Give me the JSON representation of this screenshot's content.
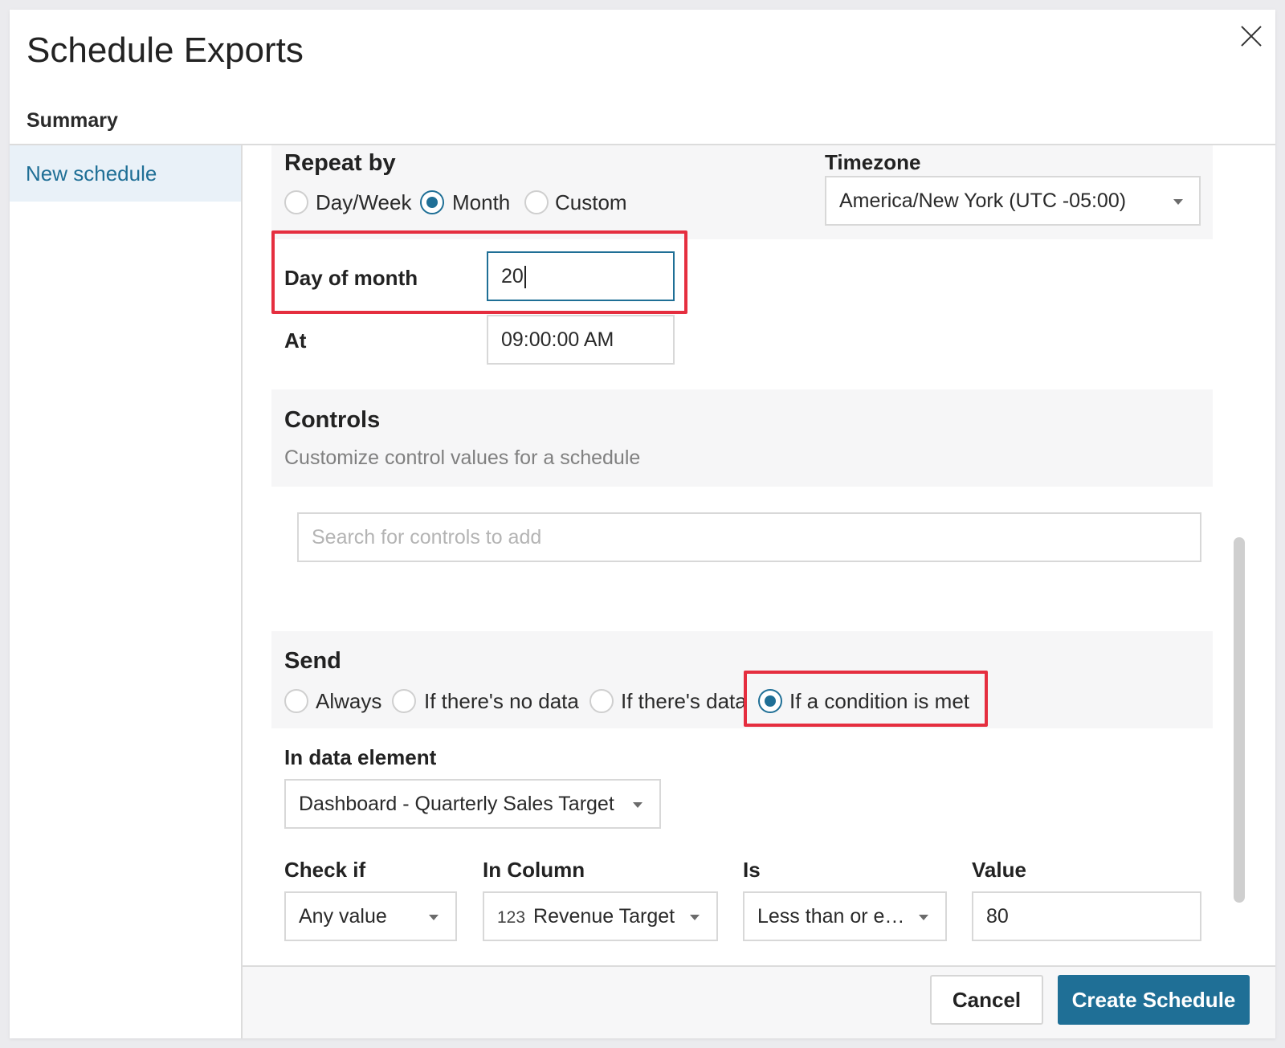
{
  "dialog": {
    "title": "Schedule Exports",
    "summary_label": "Summary",
    "close_icon": "close-icon"
  },
  "sidebar": {
    "items": [
      {
        "label": "New schedule",
        "selected": true
      }
    ]
  },
  "repeat": {
    "label": "Repeat by",
    "options": [
      "Day/Week",
      "Month",
      "Custom"
    ],
    "selected": "Month",
    "timezone_label": "Timezone",
    "timezone_value": "America/New York (UTC -05:00)"
  },
  "day_of_month": {
    "label": "Day of month",
    "value": "20"
  },
  "at": {
    "label": "At",
    "value": "09:00:00 AM"
  },
  "controls": {
    "title": "Controls",
    "subtitle": "Customize control values for a schedule",
    "search_placeholder": "Search for controls to add"
  },
  "send": {
    "title": "Send",
    "options": [
      "Always",
      "If there's no data",
      "If there's data",
      "If a condition is met"
    ],
    "selected": "If a condition is met"
  },
  "data_element": {
    "label": "In data element",
    "value": "Dashboard - Quarterly Sales Target"
  },
  "condition": {
    "check_if_label": "Check if",
    "check_if_value": "Any value",
    "column_label": "In Column",
    "column_type_icon": "123",
    "column_value": "Revenue Target",
    "is_label": "Is",
    "is_value": "Less than or e…",
    "value_label": "Value",
    "value": "80"
  },
  "footer": {
    "cancel_label": "Cancel",
    "create_label": "Create Schedule"
  },
  "colors": {
    "accent": "#1f6f96",
    "highlight": "#e52e3f",
    "panel": "#f6f6f7"
  }
}
